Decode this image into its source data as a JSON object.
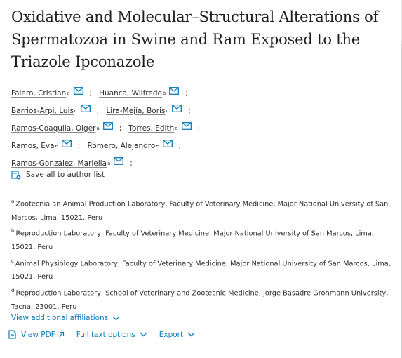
{
  "article": {
    "title": "Oxidative and Molecular–Structural Alterations of Spermatozoa in Swine and Ram Exposed to the Triazole Ipconazole"
  },
  "authors": [
    [
      {
        "name": "Falero, Cristian",
        "sup": "a"
      },
      {
        "name": "Huanca, Wilfredo",
        "sup": "b"
      }
    ],
    [
      {
        "name": "Barrios-Arpi, Luis",
        "sup": "c"
      },
      {
        "name": "Lira-Mejía, Boris",
        "sup": "c"
      }
    ],
    [
      {
        "name": "Ramos-Coaquila, Olger",
        "sup": "a"
      },
      {
        "name": "Torres, Edith",
        "sup": "d"
      }
    ],
    [
      {
        "name": "Ramos, Eva",
        "sup": "e"
      },
      {
        "name": "Romero, Alejandro",
        "sup": "e"
      }
    ],
    [
      {
        "name": "Ramos-Gonzalez, Mariella",
        "sup": "a"
      }
    ]
  ],
  "separator": ";",
  "save_authors_label": "Save all to author list",
  "affiliations": [
    {
      "sup": "a",
      "text": "Zootecnia an Animal Production Laboratory, Faculty of Veterinary Medicine, Major National University of San Marcos, Lima, 15021, Peru"
    },
    {
      "sup": "b",
      "text": "Reproduction Laboratory, Faculty of Veterinary Medicine, Major National University of San Marcos, Lima, 15021, Peru"
    },
    {
      "sup": "c",
      "text": "Animal Physiology Laboratory, Faculty of Veterinary Medicine, Major National University of San Marcos, Lima, 15021, Peru"
    },
    {
      "sup": "d",
      "text": "Reproduction Laboratory, School of Veterinary and Zootecnic Medicine, Jorge Basadre Grohmann University, Tacna, 23001, Peru"
    }
  ],
  "view_affiliations_label": "View additional affiliations",
  "toolbar": {
    "view_pdf": "View PDF",
    "full_text": "Full text options",
    "export": "Export"
  },
  "colors": {
    "link": "#0c7dbb",
    "text": "#2e2e2e"
  },
  "icons": [
    "mail-icon",
    "save-list-icon",
    "pdf-icon",
    "external-arrow-icon",
    "chevron-down-icon"
  ]
}
